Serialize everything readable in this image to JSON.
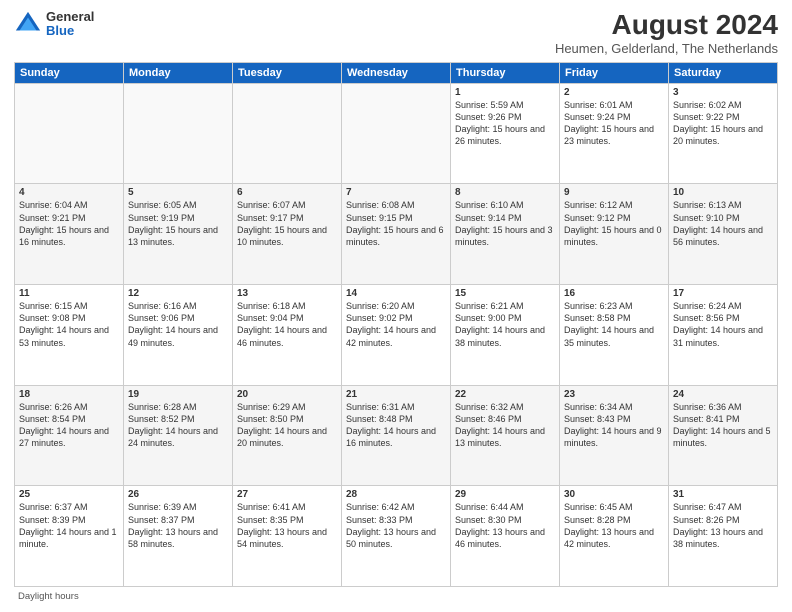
{
  "header": {
    "logo_general": "General",
    "logo_blue": "Blue",
    "month_title": "August 2024",
    "location": "Heumen, Gelderland, The Netherlands"
  },
  "days_of_week": [
    "Sunday",
    "Monday",
    "Tuesday",
    "Wednesday",
    "Thursday",
    "Friday",
    "Saturday"
  ],
  "weeks": [
    [
      {
        "day": "",
        "sunrise": "",
        "sunset": "",
        "daylight": ""
      },
      {
        "day": "",
        "sunrise": "",
        "sunset": "",
        "daylight": ""
      },
      {
        "day": "",
        "sunrise": "",
        "sunset": "",
        "daylight": ""
      },
      {
        "day": "",
        "sunrise": "",
        "sunset": "",
        "daylight": ""
      },
      {
        "day": "1",
        "sunrise": "Sunrise: 5:59 AM",
        "sunset": "Sunset: 9:26 PM",
        "daylight": "Daylight: 15 hours and 26 minutes."
      },
      {
        "day": "2",
        "sunrise": "Sunrise: 6:01 AM",
        "sunset": "Sunset: 9:24 PM",
        "daylight": "Daylight: 15 hours and 23 minutes."
      },
      {
        "day": "3",
        "sunrise": "Sunrise: 6:02 AM",
        "sunset": "Sunset: 9:22 PM",
        "daylight": "Daylight: 15 hours and 20 minutes."
      }
    ],
    [
      {
        "day": "4",
        "sunrise": "Sunrise: 6:04 AM",
        "sunset": "Sunset: 9:21 PM",
        "daylight": "Daylight: 15 hours and 16 minutes."
      },
      {
        "day": "5",
        "sunrise": "Sunrise: 6:05 AM",
        "sunset": "Sunset: 9:19 PM",
        "daylight": "Daylight: 15 hours and 13 minutes."
      },
      {
        "day": "6",
        "sunrise": "Sunrise: 6:07 AM",
        "sunset": "Sunset: 9:17 PM",
        "daylight": "Daylight: 15 hours and 10 minutes."
      },
      {
        "day": "7",
        "sunrise": "Sunrise: 6:08 AM",
        "sunset": "Sunset: 9:15 PM",
        "daylight": "Daylight: 15 hours and 6 minutes."
      },
      {
        "day": "8",
        "sunrise": "Sunrise: 6:10 AM",
        "sunset": "Sunset: 9:14 PM",
        "daylight": "Daylight: 15 hours and 3 minutes."
      },
      {
        "day": "9",
        "sunrise": "Sunrise: 6:12 AM",
        "sunset": "Sunset: 9:12 PM",
        "daylight": "Daylight: 15 hours and 0 minutes."
      },
      {
        "day": "10",
        "sunrise": "Sunrise: 6:13 AM",
        "sunset": "Sunset: 9:10 PM",
        "daylight": "Daylight: 14 hours and 56 minutes."
      }
    ],
    [
      {
        "day": "11",
        "sunrise": "Sunrise: 6:15 AM",
        "sunset": "Sunset: 9:08 PM",
        "daylight": "Daylight: 14 hours and 53 minutes."
      },
      {
        "day": "12",
        "sunrise": "Sunrise: 6:16 AM",
        "sunset": "Sunset: 9:06 PM",
        "daylight": "Daylight: 14 hours and 49 minutes."
      },
      {
        "day": "13",
        "sunrise": "Sunrise: 6:18 AM",
        "sunset": "Sunset: 9:04 PM",
        "daylight": "Daylight: 14 hours and 46 minutes."
      },
      {
        "day": "14",
        "sunrise": "Sunrise: 6:20 AM",
        "sunset": "Sunset: 9:02 PM",
        "daylight": "Daylight: 14 hours and 42 minutes."
      },
      {
        "day": "15",
        "sunrise": "Sunrise: 6:21 AM",
        "sunset": "Sunset: 9:00 PM",
        "daylight": "Daylight: 14 hours and 38 minutes."
      },
      {
        "day": "16",
        "sunrise": "Sunrise: 6:23 AM",
        "sunset": "Sunset: 8:58 PM",
        "daylight": "Daylight: 14 hours and 35 minutes."
      },
      {
        "day": "17",
        "sunrise": "Sunrise: 6:24 AM",
        "sunset": "Sunset: 8:56 PM",
        "daylight": "Daylight: 14 hours and 31 minutes."
      }
    ],
    [
      {
        "day": "18",
        "sunrise": "Sunrise: 6:26 AM",
        "sunset": "Sunset: 8:54 PM",
        "daylight": "Daylight: 14 hours and 27 minutes."
      },
      {
        "day": "19",
        "sunrise": "Sunrise: 6:28 AM",
        "sunset": "Sunset: 8:52 PM",
        "daylight": "Daylight: 14 hours and 24 minutes."
      },
      {
        "day": "20",
        "sunrise": "Sunrise: 6:29 AM",
        "sunset": "Sunset: 8:50 PM",
        "daylight": "Daylight: 14 hours and 20 minutes."
      },
      {
        "day": "21",
        "sunrise": "Sunrise: 6:31 AM",
        "sunset": "Sunset: 8:48 PM",
        "daylight": "Daylight: 14 hours and 16 minutes."
      },
      {
        "day": "22",
        "sunrise": "Sunrise: 6:32 AM",
        "sunset": "Sunset: 8:46 PM",
        "daylight": "Daylight: 14 hours and 13 minutes."
      },
      {
        "day": "23",
        "sunrise": "Sunrise: 6:34 AM",
        "sunset": "Sunset: 8:43 PM",
        "daylight": "Daylight: 14 hours and 9 minutes."
      },
      {
        "day": "24",
        "sunrise": "Sunrise: 6:36 AM",
        "sunset": "Sunset: 8:41 PM",
        "daylight": "Daylight: 14 hours and 5 minutes."
      }
    ],
    [
      {
        "day": "25",
        "sunrise": "Sunrise: 6:37 AM",
        "sunset": "Sunset: 8:39 PM",
        "daylight": "Daylight: 14 hours and 1 minute."
      },
      {
        "day": "26",
        "sunrise": "Sunrise: 6:39 AM",
        "sunset": "Sunset: 8:37 PM",
        "daylight": "Daylight: 13 hours and 58 minutes."
      },
      {
        "day": "27",
        "sunrise": "Sunrise: 6:41 AM",
        "sunset": "Sunset: 8:35 PM",
        "daylight": "Daylight: 13 hours and 54 minutes."
      },
      {
        "day": "28",
        "sunrise": "Sunrise: 6:42 AM",
        "sunset": "Sunset: 8:33 PM",
        "daylight": "Daylight: 13 hours and 50 minutes."
      },
      {
        "day": "29",
        "sunrise": "Sunrise: 6:44 AM",
        "sunset": "Sunset: 8:30 PM",
        "daylight": "Daylight: 13 hours and 46 minutes."
      },
      {
        "day": "30",
        "sunrise": "Sunrise: 6:45 AM",
        "sunset": "Sunset: 8:28 PM",
        "daylight": "Daylight: 13 hours and 42 minutes."
      },
      {
        "day": "31",
        "sunrise": "Sunrise: 6:47 AM",
        "sunset": "Sunset: 8:26 PM",
        "daylight": "Daylight: 13 hours and 38 minutes."
      }
    ]
  ],
  "footer_note": "Daylight hours"
}
